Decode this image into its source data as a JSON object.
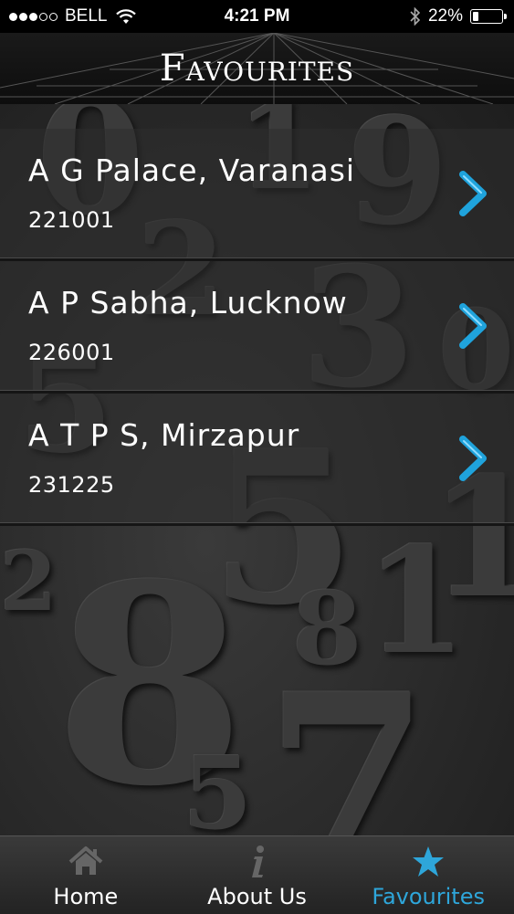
{
  "status_bar": {
    "carrier": "BELL",
    "time": "4:21 PM",
    "battery": "22%",
    "battery_level": 0.22,
    "signal_bars_filled": 3,
    "signal_bars_total": 5
  },
  "header": {
    "title": "Favourites"
  },
  "favourites": [
    {
      "name": "A G Palace, Varanasi",
      "code": "221001"
    },
    {
      "name": "A P Sabha, Lucknow",
      "code": "226001"
    },
    {
      "name": "A T P S, Mirzapur",
      "code": "231225"
    }
  ],
  "tabs": [
    {
      "label": "Home",
      "icon": "home-icon",
      "active": false
    },
    {
      "label": "About Us",
      "icon": "info-icon",
      "active": false
    },
    {
      "label": "Favourites",
      "icon": "star-icon",
      "active": true
    }
  ],
  "colors": {
    "accent": "#2ea6da",
    "chevron": "#1fa3dc"
  }
}
